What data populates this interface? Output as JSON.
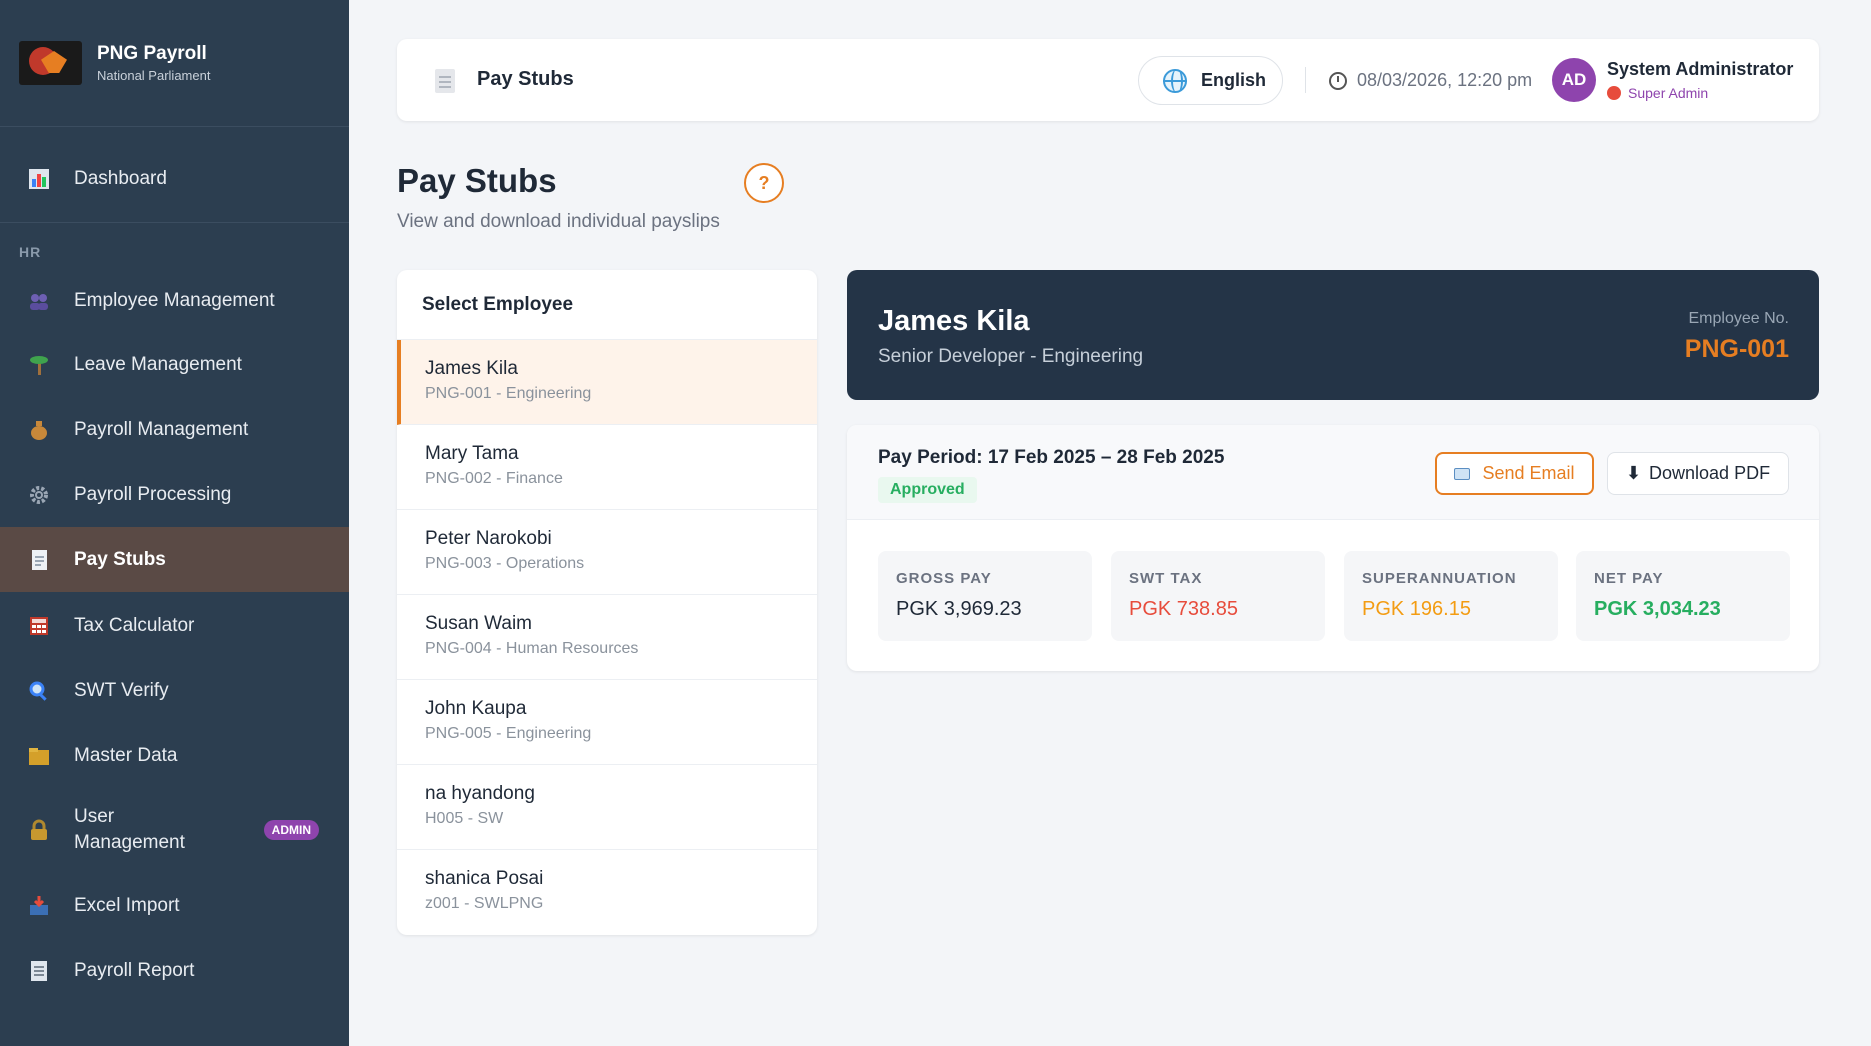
{
  "app": {
    "name": "PNG Payroll",
    "org": "National Parliament"
  },
  "sidebar": {
    "section_hr": "HR",
    "items": [
      {
        "label": "Dashboard",
        "icon": "bar-chart-icon"
      },
      {
        "label": "Employee Management",
        "icon": "people-icon"
      },
      {
        "label": "Leave Management",
        "icon": "palm-tree-icon"
      },
      {
        "label": "Payroll Management",
        "icon": "money-bag-icon"
      },
      {
        "label": "Payroll Processing",
        "icon": "gear-icon"
      },
      {
        "label": "Pay Stubs",
        "icon": "document-icon"
      },
      {
        "label": "Tax Calculator",
        "icon": "calculator-icon"
      },
      {
        "label": "SWT Verify",
        "icon": "magnifier-icon"
      },
      {
        "label": "Master Data",
        "icon": "folder-icon"
      },
      {
        "label": "User Management",
        "icon": "lock-icon",
        "badge": "ADMIN"
      },
      {
        "label": "Excel Import",
        "icon": "inbox-icon"
      },
      {
        "label": "Payroll Report",
        "icon": "report-icon"
      }
    ],
    "active": "Pay Stubs"
  },
  "topbar": {
    "crumb": "Pay Stubs",
    "language": "English",
    "datetime": "08/03/2026, 12:20 pm",
    "avatar_initials": "AD",
    "user_name": "System Administrator",
    "user_role": "Super Admin"
  },
  "page": {
    "title": "Pay Stubs",
    "subtitle": "View and download individual payslips",
    "help": "?"
  },
  "employee_list": {
    "heading": "Select Employee",
    "items": [
      {
        "name": "James Kila",
        "sub": "PNG-001 - Engineering"
      },
      {
        "name": "Mary Tama",
        "sub": "PNG-002 - Finance"
      },
      {
        "name": "Peter Narokobi",
        "sub": "PNG-003 - Operations"
      },
      {
        "name": "Susan Waim",
        "sub": "PNG-004 - Human Resources"
      },
      {
        "name": "John Kaupa",
        "sub": "PNG-005 - Engineering"
      },
      {
        "name": "na hyandong",
        "sub": "H005 - SW"
      },
      {
        "name": "shanica Posai",
        "sub": "z001 - SWLPNG"
      }
    ]
  },
  "detail": {
    "name": "James Kila",
    "role": "Senior Developer - Engineering",
    "empno_label": "Employee No.",
    "empno": "PNG-001"
  },
  "payslip": {
    "period": "Pay Period: 17 Feb 2025 – 28 Feb 2025",
    "status": "Approved",
    "send_email": "Send Email",
    "download_pdf": "Download PDF",
    "stats": [
      {
        "label": "GROSS PAY",
        "value": "PGK 3,969.23",
        "color": "#1f2937"
      },
      {
        "label": "SWT TAX",
        "value": "PGK 738.85",
        "color": "#e74c3c"
      },
      {
        "label": "SUPERANNUATION",
        "value": "PGK 196.15",
        "color": "#f39c12"
      },
      {
        "label": "NET PAY",
        "value": "PGK 3,034.23",
        "color": "#27ae60"
      }
    ]
  },
  "colors": {
    "sidebar_bg": "#2c3e50",
    "accent": "#e67e22",
    "admin_purple": "#8e44ad"
  }
}
